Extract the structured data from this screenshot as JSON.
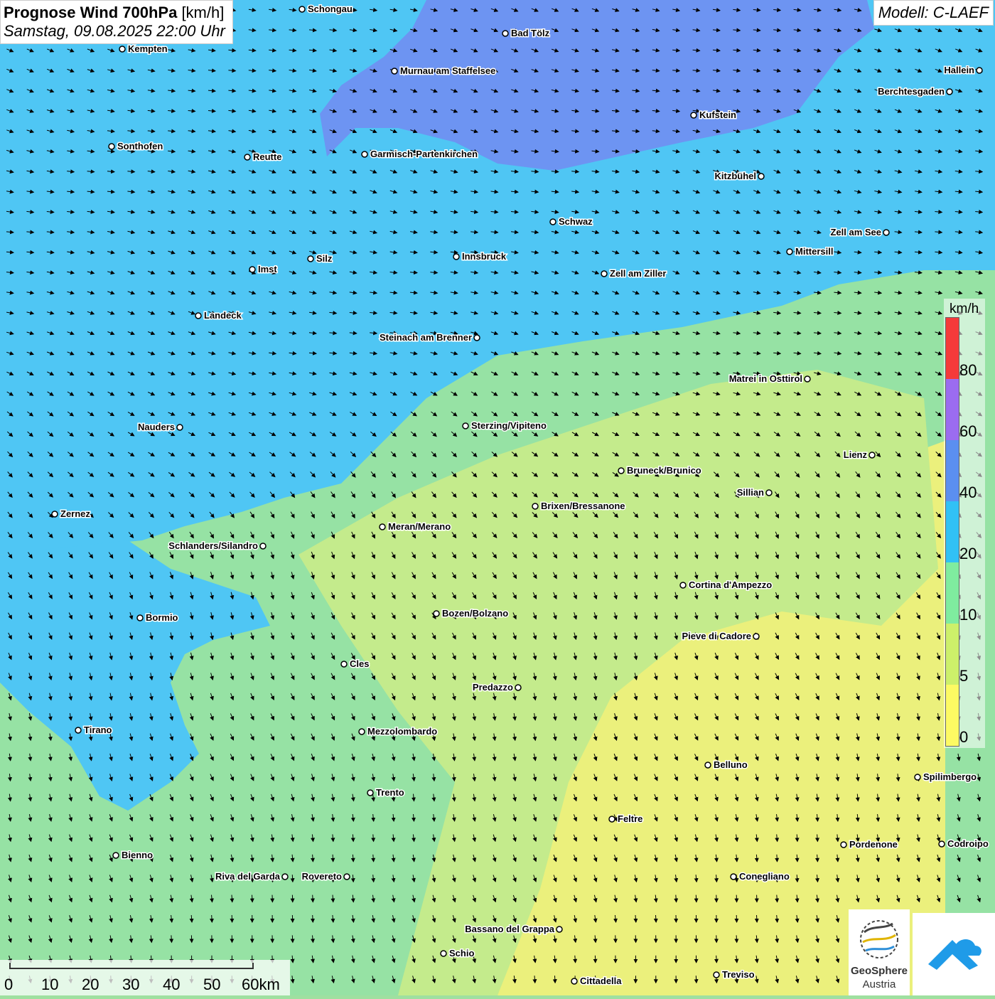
{
  "header": {
    "title_bold": "Prognose Wind 700hPa",
    "title_unit": "[km/h]",
    "datetime": "Samstag, 09.08.2025 22:00 Uhr",
    "model": "Modell: C-LAEF"
  },
  "legend": {
    "unit": "km/h",
    "ticks": [
      "80",
      "60",
      "40",
      "20",
      "10",
      "5",
      "0"
    ],
    "colors": [
      "#f53a3a",
      "#9b6cf0",
      "#5b8ff0",
      "#31c1f5",
      "#7fec9f",
      "#cdf06a",
      "#fdfa63"
    ]
  },
  "scale": {
    "labels": [
      "0",
      "10",
      "20",
      "30",
      "40",
      "50",
      "60km"
    ]
  },
  "logos": {
    "geosphere_line1": "GeoSphere",
    "geosphere_line2": "Austria"
  },
  "map_colors": {
    "strong": "#6d94f2",
    "fresh": "#4fc6f4",
    "moderate": "#96e2a4",
    "light": "#c4eb8c",
    "calm": "#ebf07c"
  },
  "places": [
    {
      "name": "Schongau",
      "label_side": "right"
    },
    {
      "name": "Bad Tölz",
      "label_side": "right"
    },
    {
      "name": "Kempten",
      "label_side": "right"
    },
    {
      "name": "Murnau am Staffelsee",
      "label_side": "right"
    },
    {
      "name": "Hallein",
      "label_side": "left"
    },
    {
      "name": "Berchtesgaden",
      "label_side": "left"
    },
    {
      "name": "Kufstein",
      "label_side": "right"
    },
    {
      "name": "Sonthofen",
      "label_side": "right"
    },
    {
      "name": "Reutte",
      "label_side": "right"
    },
    {
      "name": "Garmisch-Partenkirchen",
      "label_side": "right"
    },
    {
      "name": "Kitzbühel",
      "label_side": "left"
    },
    {
      "name": "Schwaz",
      "label_side": "right"
    },
    {
      "name": "Zell am See",
      "label_side": "left"
    },
    {
      "name": "Innsbruck",
      "label_side": "right"
    },
    {
      "name": "Silz",
      "label_side": "right"
    },
    {
      "name": "Mittersill",
      "label_side": "right"
    },
    {
      "name": "Imst",
      "label_side": "right"
    },
    {
      "name": "Zell am Ziller",
      "label_side": "right"
    },
    {
      "name": "Landeck",
      "label_side": "right"
    },
    {
      "name": "Steinach am Brenner",
      "label_side": "left"
    },
    {
      "name": "Matrei in Osttirol",
      "label_side": "left"
    },
    {
      "name": "Nauders",
      "label_side": "left"
    },
    {
      "name": "Sterzing/Vipiteno",
      "label_side": "right"
    },
    {
      "name": "Lienz",
      "label_side": "left"
    },
    {
      "name": "Bruneck/Brunico",
      "label_side": "right"
    },
    {
      "name": "Sillian",
      "label_side": "left"
    },
    {
      "name": "Brixen/Bressanone",
      "label_side": "right"
    },
    {
      "name": "Zernez",
      "label_side": "right"
    },
    {
      "name": "Meran/Merano",
      "label_side": "right"
    },
    {
      "name": "Schlanders/Silandro",
      "label_side": "left"
    },
    {
      "name": "Cortina d'Ampezzo",
      "label_side": "right"
    },
    {
      "name": "Bozen/Bolzano",
      "label_side": "right"
    },
    {
      "name": "Bormio",
      "label_side": "right"
    },
    {
      "name": "Pieve di Cadore",
      "label_side": "left"
    },
    {
      "name": "Cles",
      "label_side": "right"
    },
    {
      "name": "Predazzo",
      "label_side": "left"
    },
    {
      "name": "Tirano",
      "label_side": "right"
    },
    {
      "name": "Mezzolombardo",
      "label_side": "right"
    },
    {
      "name": "Belluno",
      "label_side": "right"
    },
    {
      "name": "Spilimbergo",
      "label_side": "right"
    },
    {
      "name": "Trento",
      "label_side": "right"
    },
    {
      "name": "Feltre",
      "label_side": "right"
    },
    {
      "name": "Pordenone",
      "label_side": "right"
    },
    {
      "name": "Codroipo",
      "label_side": "right"
    },
    {
      "name": "Bienno",
      "label_side": "right"
    },
    {
      "name": "Riva del Garda",
      "label_side": "left"
    },
    {
      "name": "Rovereto",
      "label_side": "left"
    },
    {
      "name": "Conegliano",
      "label_side": "right"
    },
    {
      "name": "Bassano del Grappa",
      "label_side": "left"
    },
    {
      "name": "Schio",
      "label_side": "right"
    },
    {
      "name": "Treviso",
      "label_side": "right"
    },
    {
      "name": "Cittadella",
      "label_side": "right"
    }
  ]
}
